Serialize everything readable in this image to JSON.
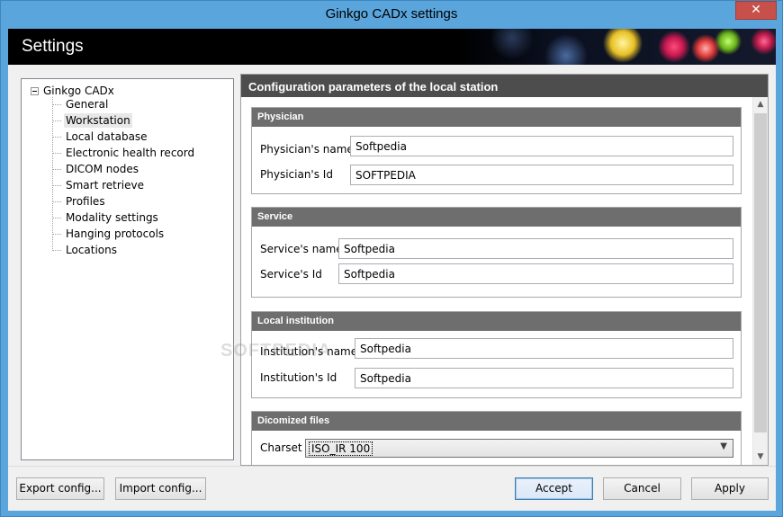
{
  "window": {
    "title": "Ginkgo CADx settings",
    "close_glyph": "✕"
  },
  "banner": {
    "title": "Settings"
  },
  "tree": {
    "root": "Ginkgo CADx",
    "items": [
      {
        "label": "General"
      },
      {
        "label": "Workstation"
      },
      {
        "label": "Local database"
      },
      {
        "label": "Electronic health record"
      },
      {
        "label": "DICOM nodes"
      },
      {
        "label": "Smart retrieve"
      },
      {
        "label": "Profiles"
      },
      {
        "label": "Modality settings"
      },
      {
        "label": "Hanging protocols"
      },
      {
        "label": "Locations"
      }
    ]
  },
  "config": {
    "header": "Configuration parameters of the local station",
    "physician": {
      "title": "Physician",
      "name_label": "Physician's name",
      "name_value": "Softpedia",
      "id_label": "Physician's Id",
      "id_value": "SOFTPEDIA"
    },
    "service": {
      "title": "Service",
      "name_label": "Service's name",
      "name_value": "Softpedia",
      "id_label": "Service's Id",
      "id_value": "Softpedia"
    },
    "institution": {
      "title": "Local institution",
      "name_label": "Institution's name",
      "name_value": "Softpedia",
      "id_label": "Institution's Id",
      "id_value": "Softpedia"
    },
    "dicomized": {
      "title": "Dicomized files",
      "charset_label": "Charset",
      "charset_value": "ISO_IR 100"
    }
  },
  "buttons": {
    "export": "Export config...",
    "import": "Import config...",
    "accept": "Accept",
    "cancel": "Cancel",
    "apply": "Apply"
  },
  "watermark": "SOFTPEDIA"
}
